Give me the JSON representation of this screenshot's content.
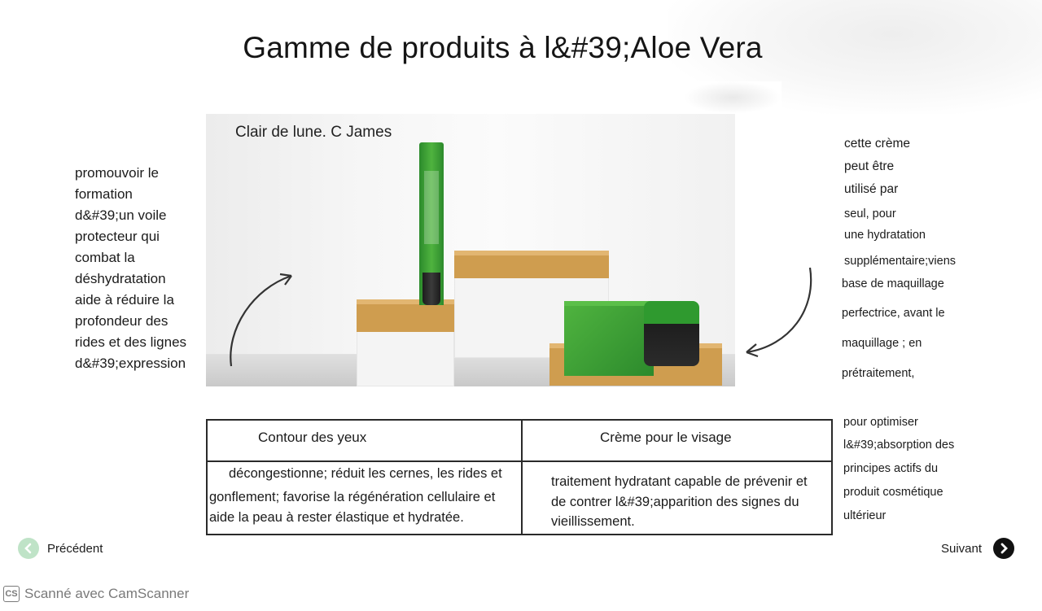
{
  "title": "Gamme de produits à l&#39;Aloe Vera",
  "photo": {
    "caption": "Clair de lune. C James"
  },
  "left_text": [
    " promouvoir le",
    "formation",
    "d&#39;un voile",
    "protecteur qui",
    "combat la",
    "déshydratation",
    "aide à réduire la",
    "profondeur des",
    "rides et des lignes",
    "d&#39;expression"
  ],
  "right_text": [
    "cette crème",
    "peut être",
    "utilisé par",
    "seul, pour",
    "une hydratation",
    "supplémentaire;viens",
    "base de maquillage",
    "perfectrice, avant le",
    "maquillage ; en",
    "prétraitement,",
    "pour optimiser",
    "l&#39;absorption des",
    "principes actifs du",
    "produit cosmétique",
    "ultérieur"
  ],
  "table": {
    "headers": [
      "Contour des yeux",
      "Crème pour le visage"
    ],
    "col1_lines": [
      "décongestionne; réduit les cernes, les rides et",
      "gonflement; favorise la régénération cellulaire et",
      "aide la peau à rester élastique et hydratée."
    ],
    "col2_lines": [
      "traitement hydratant capable de prévenir et",
      "de contrer l&#39;apparition des signes du",
      "vieillissement."
    ]
  },
  "nav": {
    "prev_label": "Précédent",
    "next_label": "Suivant",
    "prev_icon": "chevron-left-icon",
    "next_icon": "chevron-right-icon"
  },
  "watermark": {
    "logo_text": "CS",
    "text": "Scanné avec CamScanner"
  },
  "colors": {
    "green": "#2e9a2e",
    "gold": "#cf9d4f",
    "prev_circle": "#bfe3c7",
    "next_circle": "#111111"
  }
}
